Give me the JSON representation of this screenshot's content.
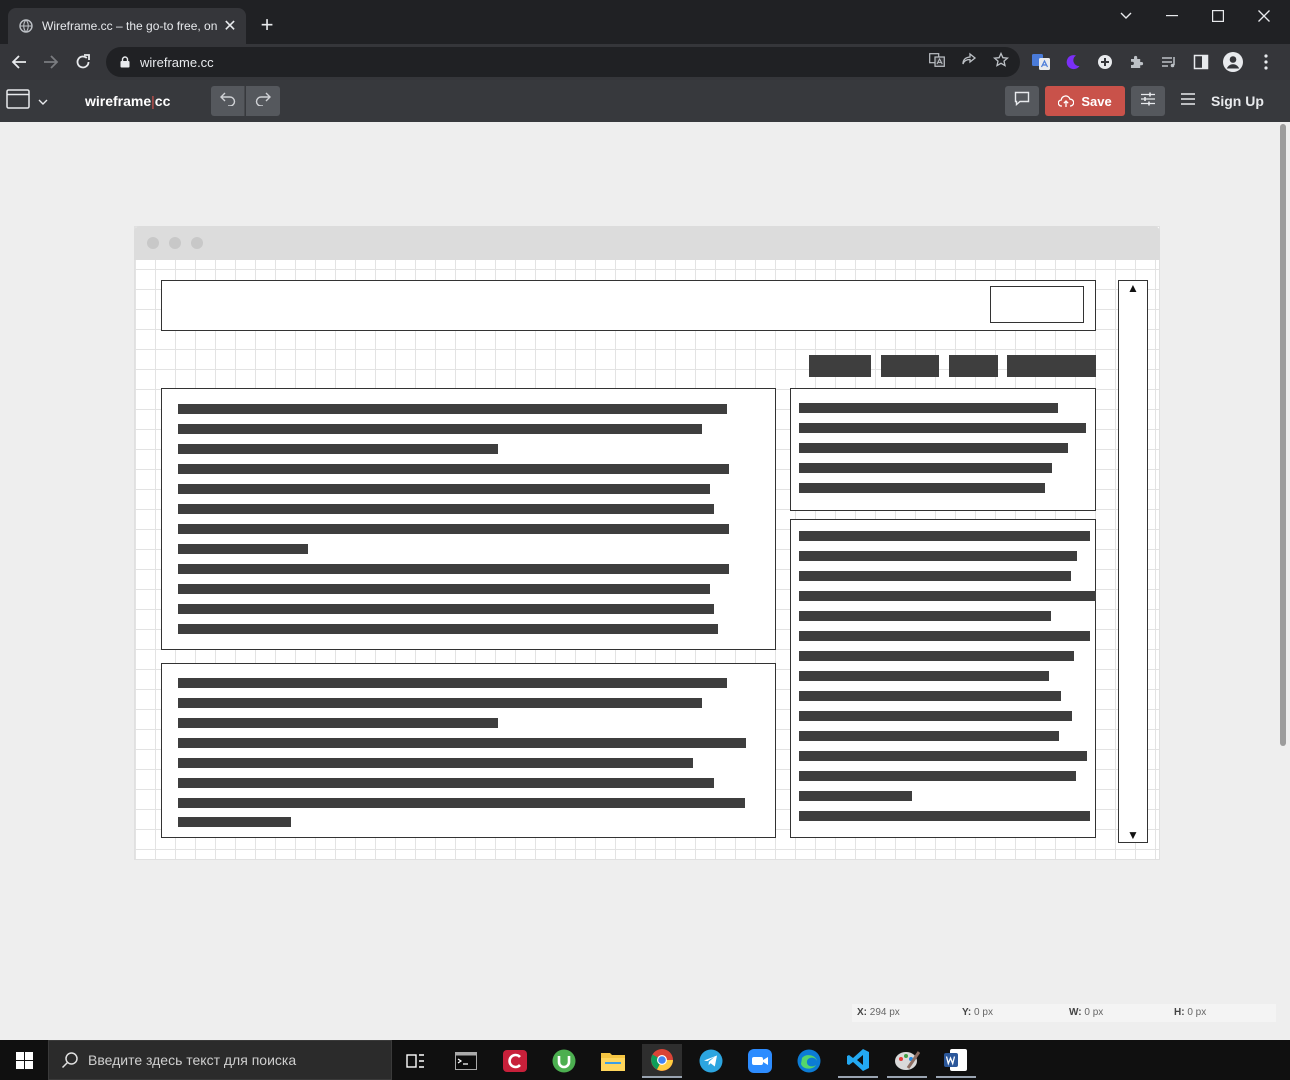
{
  "browser": {
    "tab_title": "Wireframe.cc – the go-to free, on",
    "new_tab": "+",
    "tab_close": "✕",
    "url": "wireframe.cc"
  },
  "app": {
    "logo_left": "wireframe",
    "logo_sep": "|",
    "logo_right": "cc",
    "save_label": "Save",
    "signup_label": "Sign Up"
  },
  "status": {
    "x_label": "X:",
    "x_value": "294 px",
    "y_label": "Y:",
    "y_value": "0 px",
    "w_label": "W:",
    "w_value": "0 px",
    "h_label": "H:",
    "h_value": "0 px"
  },
  "wireframe_scrollbar": {
    "up": "▲",
    "down": "▼"
  },
  "taskbar": {
    "search_placeholder": "Введите здесь текст для поиска",
    "apps": [
      "task-view",
      "terminal",
      "ccleaner",
      "utorrent",
      "file-explorer",
      "chrome",
      "telegram",
      "zoom",
      "edge",
      "vscode",
      "paint",
      "word"
    ]
  },
  "colors": {
    "save_button": "#c9524a",
    "app_bar": "#37393d",
    "tab_strip": "#202124",
    "wireframe_bar": "#3e3e3e"
  }
}
